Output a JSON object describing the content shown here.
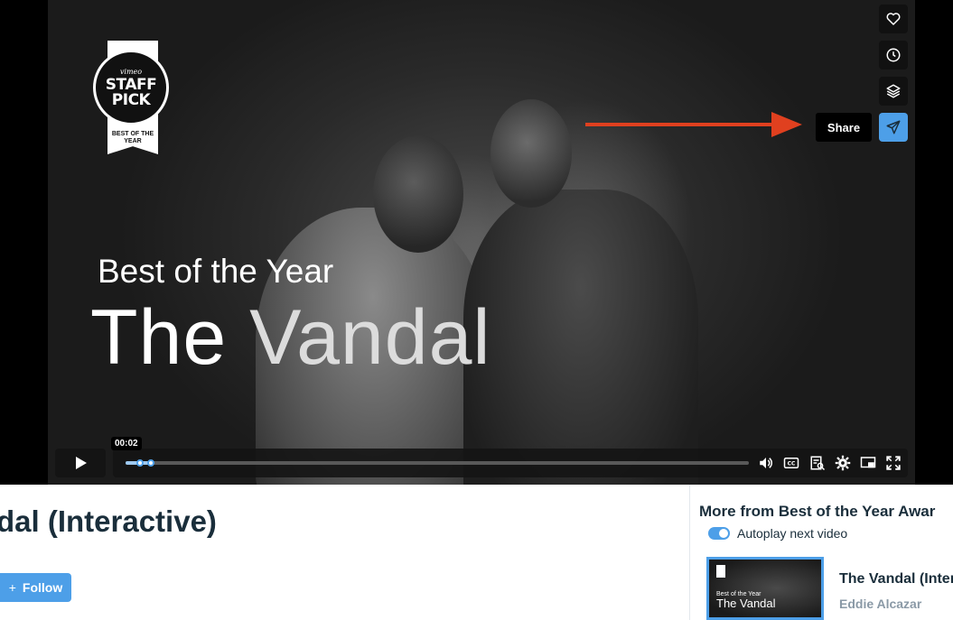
{
  "player": {
    "staff_pick": {
      "brand": "vimeo",
      "line1": "STAFF",
      "line2": "PICK",
      "subtitle": "BEST OF THE YEAR"
    },
    "overlay_subtitle": "Best of the Year",
    "overlay_title_part1": "The",
    "overlay_title_part2": "Vandal",
    "side_actions": [
      {
        "name": "like",
        "icon": "heart-icon"
      },
      {
        "name": "watch-later",
        "icon": "clock-icon"
      },
      {
        "name": "collections",
        "icon": "layers-icon"
      },
      {
        "name": "share",
        "icon": "paper-plane-icon"
      }
    ],
    "share_tooltip": "Share",
    "current_time": "00:02",
    "progress": 0.04,
    "icons": [
      "play-icon",
      "volume-icon",
      "cc-icon",
      "transcript-icon",
      "settings-icon",
      "pip-icon",
      "fullscreen-icon"
    ],
    "accent_color": "#4d9fe8",
    "arrow_color": "#e0401f"
  },
  "video": {
    "title": "dal (Interactive)",
    "follow_label": "Follow"
  },
  "sidebar": {
    "heading": "More from Best of the Year Awar",
    "autoplay_label": "Autoplay next video",
    "autoplay_on": true,
    "next_video": {
      "thumb_subtitle": "Best of the Year",
      "thumb_title": "The Vandal",
      "title": "The Vandal (Inter",
      "author": "Eddie Alcazar"
    }
  }
}
